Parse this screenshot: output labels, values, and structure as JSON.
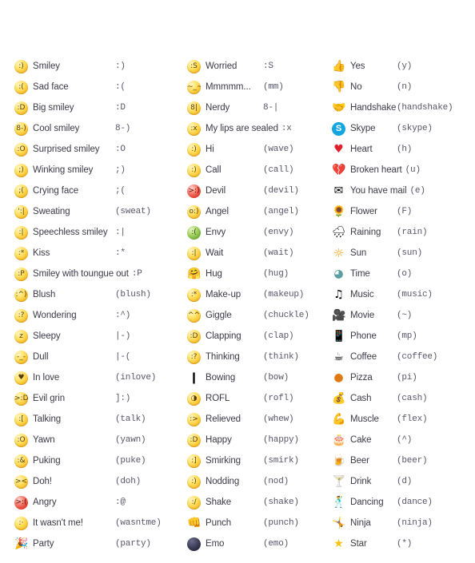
{
  "page": {
    "title": "Skype emoticons list",
    "background_color": "#ffffff",
    "text_color": "#3a3a48",
    "code_color": "#56566a"
  },
  "columns": [
    {
      "name": "column-1",
      "rows": [
        {
          "icon": "smiley-icon",
          "label": "Smiley",
          "code": ":)",
          "inline": false,
          "style": "ball",
          "face": ":)"
        },
        {
          "icon": "sad-face-icon",
          "label": "Sad face",
          "code": ":(",
          "inline": false,
          "style": "ball",
          "face": ":("
        },
        {
          "icon": "big-smiley-icon",
          "label": "Big smiley",
          "code": ":D",
          "inline": false,
          "style": "ball",
          "face": ":D"
        },
        {
          "icon": "cool-smiley-icon",
          "label": "Cool smiley",
          "code": "8-)",
          "inline": false,
          "style": "ball",
          "face": "8-)"
        },
        {
          "icon": "surprised-smiley-icon",
          "label": "Surprised smiley",
          "code": ":O",
          "inline": false,
          "style": "ball",
          "face": ":O"
        },
        {
          "icon": "winking-smiley-icon",
          "label": "Winking smiley",
          "code": ";)",
          "inline": false,
          "style": "ball",
          "face": ";)"
        },
        {
          "icon": "crying-face-icon",
          "label": "Crying face",
          "code": ";(",
          "inline": false,
          "style": "ball",
          "face": ";("
        },
        {
          "icon": "sweating-icon",
          "label": "Sweating",
          "code": "(sweat)",
          "inline": false,
          "style": "ball",
          "face": "':|"
        },
        {
          "icon": "speechless-smiley-icon",
          "label": "Speechless smiley",
          "code": ":|",
          "inline": false,
          "style": "ball",
          "face": ":|"
        },
        {
          "icon": "kiss-icon",
          "label": "Kiss",
          "code": ":*",
          "inline": false,
          "style": "ball",
          "face": ":*"
        },
        {
          "icon": "tongue-out-smiley-icon",
          "label": "Smiley with toungue out",
          "code": ":P",
          "inline": true,
          "style": "ball",
          "face": ":P"
        },
        {
          "icon": "blush-icon",
          "label": "Blush",
          "code": "(blush)",
          "inline": false,
          "style": "ball",
          "face": ":^)"
        },
        {
          "icon": "wondering-icon",
          "label": "Wondering",
          "code": ":^)",
          "inline": false,
          "style": "ball",
          "face": ":?"
        },
        {
          "icon": "sleepy-icon",
          "label": "Sleepy",
          "code": "|-)",
          "inline": false,
          "style": "ball",
          "face": "z"
        },
        {
          "icon": "dull-icon",
          "label": "Dull",
          "code": "|-(",
          "inline": false,
          "style": "ball",
          "face": "-_-"
        },
        {
          "icon": "in-love-icon",
          "label": "In love",
          "code": "(inlove)",
          "inline": false,
          "style": "ball",
          "face": "♥"
        },
        {
          "icon": "evil-grin-icon",
          "label": "Evil grin",
          "code": "]:)",
          "inline": false,
          "style": "ball",
          "face": ">:D"
        },
        {
          "icon": "talking-icon",
          "label": "Talking",
          "code": "(talk)",
          "inline": false,
          "style": "ball",
          "face": ":["
        },
        {
          "icon": "yawn-icon",
          "label": "Yawn",
          "code": "(yawn)",
          "inline": false,
          "style": "ball",
          "face": ":O"
        },
        {
          "icon": "puking-icon",
          "label": "Puking",
          "code": "(puke)",
          "inline": false,
          "style": "ball",
          "face": ":&"
        },
        {
          "icon": "doh-icon",
          "label": "Doh!",
          "code": "(doh)",
          "inline": false,
          "style": "ball",
          "face": "><"
        },
        {
          "icon": "angry-icon",
          "label": "Angry",
          "code": ":@",
          "inline": false,
          "style": "ball-red",
          "face": ">:("
        },
        {
          "icon": "wasnt-me-icon",
          "label": "It wasn't me!",
          "code": "(wasntme)",
          "inline": false,
          "style": "ball",
          "face": ":·"
        },
        {
          "icon": "party-icon",
          "label": "Party",
          "code": "(party)",
          "inline": false,
          "style": "glyph",
          "face": "🎉"
        }
      ]
    },
    {
      "name": "column-2",
      "rows": [
        {
          "icon": "worried-icon",
          "label": "Worried",
          "code": ":S",
          "inline": false,
          "style": "ball",
          "face": ":S"
        },
        {
          "icon": "mmmmm-icon",
          "label": "Mmmmm...",
          "code": "(mm)",
          "inline": false,
          "style": "ball",
          "face": "~_~"
        },
        {
          "icon": "nerdy-icon",
          "label": "Nerdy",
          "code": "8-|",
          "inline": false,
          "style": "ball",
          "face": "8|"
        },
        {
          "icon": "lips-are-sealed-icon",
          "label": "My lips are sealed",
          "code": ":x",
          "inline": true,
          "style": "ball",
          "face": ":x"
        },
        {
          "icon": "hi-wave-icon",
          "label": "Hi",
          "code": "(wave)",
          "inline": false,
          "style": "ball",
          "face": ":)"
        },
        {
          "icon": "call-icon",
          "label": "Call",
          "code": "(call)",
          "inline": false,
          "style": "ball",
          "face": ":)"
        },
        {
          "icon": "devil-icon",
          "label": "Devil",
          "code": "(devil)",
          "inline": false,
          "style": "ball-red",
          "face": ">:)"
        },
        {
          "icon": "angel-icon",
          "label": "Angel",
          "code": "(angel)",
          "inline": false,
          "style": "ball",
          "face": "o:)"
        },
        {
          "icon": "envy-icon",
          "label": "Envy",
          "code": "(envy)",
          "inline": false,
          "style": "ball-green",
          "face": ":("
        },
        {
          "icon": "wait-icon",
          "label": "Wait",
          "code": "(wait)",
          "inline": false,
          "style": "ball",
          "face": ":|"
        },
        {
          "icon": "hug-icon",
          "label": "Hug",
          "code": "(hug)",
          "inline": false,
          "style": "glyph",
          "face": "🤗"
        },
        {
          "icon": "make-up-icon",
          "label": "Make-up",
          "code": "(makeup)",
          "inline": false,
          "style": "ball",
          "face": ":*"
        },
        {
          "icon": "giggle-icon",
          "label": "Giggle",
          "code": "(chuckle)",
          "inline": false,
          "style": "ball",
          "face": "^^"
        },
        {
          "icon": "clapping-icon",
          "label": "Clapping",
          "code": "(clap)",
          "inline": false,
          "style": "ball",
          "face": ":D"
        },
        {
          "icon": "thinking-icon",
          "label": "Thinking",
          "code": "(think)",
          "inline": false,
          "style": "ball",
          "face": ":?"
        },
        {
          "icon": "bowing-icon",
          "label": "Bowing",
          "code": "(bow)",
          "inline": false,
          "style": "glyph",
          "face": "❙"
        },
        {
          "icon": "rofl-icon",
          "label": "ROFL",
          "code": "(rofl)",
          "inline": false,
          "style": "ball",
          "face": "◑"
        },
        {
          "icon": "relieved-icon",
          "label": "Relieved",
          "code": "(whew)",
          "inline": false,
          "style": "ball",
          "face": ":>"
        },
        {
          "icon": "happy-icon",
          "label": "Happy",
          "code": "(happy)",
          "inline": false,
          "style": "ball",
          "face": ":D"
        },
        {
          "icon": "smirking-icon",
          "label": "Smirking",
          "code": "(smirk)",
          "inline": false,
          "style": "ball",
          "face": ":]"
        },
        {
          "icon": "nodding-icon",
          "label": "Nodding",
          "code": "(nod)",
          "inline": false,
          "style": "ball",
          "face": ":)"
        },
        {
          "icon": "shake-icon",
          "label": "Shake",
          "code": "(shake)",
          "inline": false,
          "style": "ball",
          "face": ":/"
        },
        {
          "icon": "punch-icon",
          "label": "Punch",
          "code": "(punch)",
          "inline": false,
          "style": "glyph",
          "face": "👊"
        },
        {
          "icon": "emo-icon",
          "label": "Emo",
          "code": "(emo)",
          "inline": false,
          "style": "ball-dark",
          "face": ""
        }
      ]
    },
    {
      "name": "column-3",
      "rows": [
        {
          "icon": "thumbs-up-icon",
          "label": "Yes",
          "code": "(y)",
          "inline": false,
          "style": "glyph",
          "face": "👍"
        },
        {
          "icon": "thumbs-down-icon",
          "label": "No",
          "code": "(n)",
          "inline": false,
          "style": "glyph",
          "face": "👎"
        },
        {
          "icon": "handshake-icon",
          "label": "Handshake",
          "code": "(handshake)",
          "inline": false,
          "style": "glyph",
          "face": "🤝"
        },
        {
          "icon": "skype-icon",
          "label": "Skype",
          "code": "(skype)",
          "inline": false,
          "style": "skype",
          "face": "S"
        },
        {
          "icon": "heart-icon",
          "label": "Heart",
          "code": "(h)",
          "inline": false,
          "style": "heart",
          "face": "♥"
        },
        {
          "icon": "broken-heart-icon",
          "label": "Broken heart",
          "code": "(u)",
          "inline": true,
          "style": "heart",
          "face": "💔"
        },
        {
          "icon": "mail-icon",
          "label": "You have mail",
          "code": "(e)",
          "inline": true,
          "style": "glyph",
          "face": "✉"
        },
        {
          "icon": "flower-icon",
          "label": "Flower",
          "code": "(F)",
          "inline": false,
          "style": "glyph",
          "face": "🌻"
        },
        {
          "icon": "raining-icon",
          "label": "Raining",
          "code": "(rain)",
          "inline": false,
          "style": "glyph",
          "face": "🌧"
        },
        {
          "icon": "sun-icon",
          "label": "Sun",
          "code": "(sun)",
          "inline": false,
          "style": "sun",
          "face": "☼"
        },
        {
          "icon": "time-clock-icon",
          "label": "Time",
          "code": "(o)",
          "inline": false,
          "style": "clock",
          "face": "◕"
        },
        {
          "icon": "music-note-icon",
          "label": "Music",
          "code": "(music)",
          "inline": false,
          "style": "glyph",
          "face": "♫"
        },
        {
          "icon": "movie-camera-icon",
          "label": "Movie",
          "code": "(~)",
          "inline": false,
          "style": "glyph",
          "face": "🎥"
        },
        {
          "icon": "phone-icon",
          "label": "Phone",
          "code": "(mp)",
          "inline": false,
          "style": "glyph",
          "face": "📱"
        },
        {
          "icon": "coffee-icon",
          "label": "Coffee",
          "code": "(coffee)",
          "inline": false,
          "style": "glyph",
          "face": "☕"
        },
        {
          "icon": "pizza-icon",
          "label": "Pizza",
          "code": "(pi)",
          "inline": false,
          "style": "pizza",
          "face": "●"
        },
        {
          "icon": "cash-icon",
          "label": "Cash",
          "code": "(cash)",
          "inline": false,
          "style": "glyph",
          "face": "💰"
        },
        {
          "icon": "muscle-flex-icon",
          "label": "Muscle",
          "code": "(flex)",
          "inline": false,
          "style": "glyph",
          "face": "💪"
        },
        {
          "icon": "cake-icon",
          "label": "Cake",
          "code": "(^)",
          "inline": false,
          "style": "glyph",
          "face": "🎂"
        },
        {
          "icon": "beer-icon",
          "label": "Beer",
          "code": "(beer)",
          "inline": false,
          "style": "glyph",
          "face": "🍺"
        },
        {
          "icon": "drink-cocktail-icon",
          "label": "Drink",
          "code": "(d)",
          "inline": false,
          "style": "glyph",
          "face": "🍸"
        },
        {
          "icon": "dancing-icon",
          "label": "Dancing",
          "code": "(dance)",
          "inline": false,
          "style": "glyph",
          "face": "🕺"
        },
        {
          "icon": "ninja-icon",
          "label": "Ninja",
          "code": "(ninja)",
          "inline": false,
          "style": "glyph",
          "face": "🤸"
        },
        {
          "icon": "star-icon",
          "label": "Star",
          "code": "(*)",
          "inline": false,
          "style": "star",
          "face": "★"
        }
      ]
    }
  ]
}
